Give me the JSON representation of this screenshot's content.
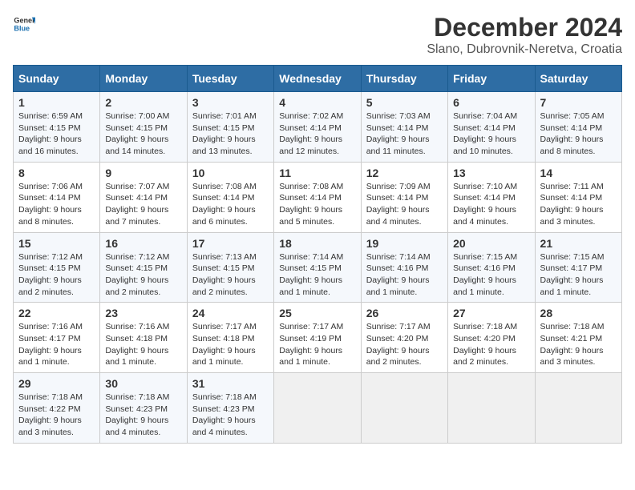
{
  "logo": {
    "text_general": "General",
    "text_blue": "Blue"
  },
  "title": "December 2024",
  "subtitle": "Slano, Dubrovnik-Neretva, Croatia",
  "days_of_week": [
    "Sunday",
    "Monday",
    "Tuesday",
    "Wednesday",
    "Thursday",
    "Friday",
    "Saturday"
  ],
  "weeks": [
    [
      {
        "day": "1",
        "sunrise": "Sunrise: 6:59 AM",
        "sunset": "Sunset: 4:15 PM",
        "daylight": "Daylight: 9 hours and 16 minutes."
      },
      {
        "day": "2",
        "sunrise": "Sunrise: 7:00 AM",
        "sunset": "Sunset: 4:15 PM",
        "daylight": "Daylight: 9 hours and 14 minutes."
      },
      {
        "day": "3",
        "sunrise": "Sunrise: 7:01 AM",
        "sunset": "Sunset: 4:15 PM",
        "daylight": "Daylight: 9 hours and 13 minutes."
      },
      {
        "day": "4",
        "sunrise": "Sunrise: 7:02 AM",
        "sunset": "Sunset: 4:14 PM",
        "daylight": "Daylight: 9 hours and 12 minutes."
      },
      {
        "day": "5",
        "sunrise": "Sunrise: 7:03 AM",
        "sunset": "Sunset: 4:14 PM",
        "daylight": "Daylight: 9 hours and 11 minutes."
      },
      {
        "day": "6",
        "sunrise": "Sunrise: 7:04 AM",
        "sunset": "Sunset: 4:14 PM",
        "daylight": "Daylight: 9 hours and 10 minutes."
      },
      {
        "day": "7",
        "sunrise": "Sunrise: 7:05 AM",
        "sunset": "Sunset: 4:14 PM",
        "daylight": "Daylight: 9 hours and 8 minutes."
      }
    ],
    [
      {
        "day": "8",
        "sunrise": "Sunrise: 7:06 AM",
        "sunset": "Sunset: 4:14 PM",
        "daylight": "Daylight: 9 hours and 8 minutes."
      },
      {
        "day": "9",
        "sunrise": "Sunrise: 7:07 AM",
        "sunset": "Sunset: 4:14 PM",
        "daylight": "Daylight: 9 hours and 7 minutes."
      },
      {
        "day": "10",
        "sunrise": "Sunrise: 7:08 AM",
        "sunset": "Sunset: 4:14 PM",
        "daylight": "Daylight: 9 hours and 6 minutes."
      },
      {
        "day": "11",
        "sunrise": "Sunrise: 7:08 AM",
        "sunset": "Sunset: 4:14 PM",
        "daylight": "Daylight: 9 hours and 5 minutes."
      },
      {
        "day": "12",
        "sunrise": "Sunrise: 7:09 AM",
        "sunset": "Sunset: 4:14 PM",
        "daylight": "Daylight: 9 hours and 4 minutes."
      },
      {
        "day": "13",
        "sunrise": "Sunrise: 7:10 AM",
        "sunset": "Sunset: 4:14 PM",
        "daylight": "Daylight: 9 hours and 4 minutes."
      },
      {
        "day": "14",
        "sunrise": "Sunrise: 7:11 AM",
        "sunset": "Sunset: 4:14 PM",
        "daylight": "Daylight: 9 hours and 3 minutes."
      }
    ],
    [
      {
        "day": "15",
        "sunrise": "Sunrise: 7:12 AM",
        "sunset": "Sunset: 4:15 PM",
        "daylight": "Daylight: 9 hours and 2 minutes."
      },
      {
        "day": "16",
        "sunrise": "Sunrise: 7:12 AM",
        "sunset": "Sunset: 4:15 PM",
        "daylight": "Daylight: 9 hours and 2 minutes."
      },
      {
        "day": "17",
        "sunrise": "Sunrise: 7:13 AM",
        "sunset": "Sunset: 4:15 PM",
        "daylight": "Daylight: 9 hours and 2 minutes."
      },
      {
        "day": "18",
        "sunrise": "Sunrise: 7:14 AM",
        "sunset": "Sunset: 4:15 PM",
        "daylight": "Daylight: 9 hours and 1 minute."
      },
      {
        "day": "19",
        "sunrise": "Sunrise: 7:14 AM",
        "sunset": "Sunset: 4:16 PM",
        "daylight": "Daylight: 9 hours and 1 minute."
      },
      {
        "day": "20",
        "sunrise": "Sunrise: 7:15 AM",
        "sunset": "Sunset: 4:16 PM",
        "daylight": "Daylight: 9 hours and 1 minute."
      },
      {
        "day": "21",
        "sunrise": "Sunrise: 7:15 AM",
        "sunset": "Sunset: 4:17 PM",
        "daylight": "Daylight: 9 hours and 1 minute."
      }
    ],
    [
      {
        "day": "22",
        "sunrise": "Sunrise: 7:16 AM",
        "sunset": "Sunset: 4:17 PM",
        "daylight": "Daylight: 9 hours and 1 minute."
      },
      {
        "day": "23",
        "sunrise": "Sunrise: 7:16 AM",
        "sunset": "Sunset: 4:18 PM",
        "daylight": "Daylight: 9 hours and 1 minute."
      },
      {
        "day": "24",
        "sunrise": "Sunrise: 7:17 AM",
        "sunset": "Sunset: 4:18 PM",
        "daylight": "Daylight: 9 hours and 1 minute."
      },
      {
        "day": "25",
        "sunrise": "Sunrise: 7:17 AM",
        "sunset": "Sunset: 4:19 PM",
        "daylight": "Daylight: 9 hours and 1 minute."
      },
      {
        "day": "26",
        "sunrise": "Sunrise: 7:17 AM",
        "sunset": "Sunset: 4:20 PM",
        "daylight": "Daylight: 9 hours and 2 minutes."
      },
      {
        "day": "27",
        "sunrise": "Sunrise: 7:18 AM",
        "sunset": "Sunset: 4:20 PM",
        "daylight": "Daylight: 9 hours and 2 minutes."
      },
      {
        "day": "28",
        "sunrise": "Sunrise: 7:18 AM",
        "sunset": "Sunset: 4:21 PM",
        "daylight": "Daylight: 9 hours and 3 minutes."
      }
    ],
    [
      {
        "day": "29",
        "sunrise": "Sunrise: 7:18 AM",
        "sunset": "Sunset: 4:22 PM",
        "daylight": "Daylight: 9 hours and 3 minutes."
      },
      {
        "day": "30",
        "sunrise": "Sunrise: 7:18 AM",
        "sunset": "Sunset: 4:23 PM",
        "daylight": "Daylight: 9 hours and 4 minutes."
      },
      {
        "day": "31",
        "sunrise": "Sunrise: 7:18 AM",
        "sunset": "Sunset: 4:23 PM",
        "daylight": "Daylight: 9 hours and 4 minutes."
      },
      null,
      null,
      null,
      null
    ]
  ]
}
